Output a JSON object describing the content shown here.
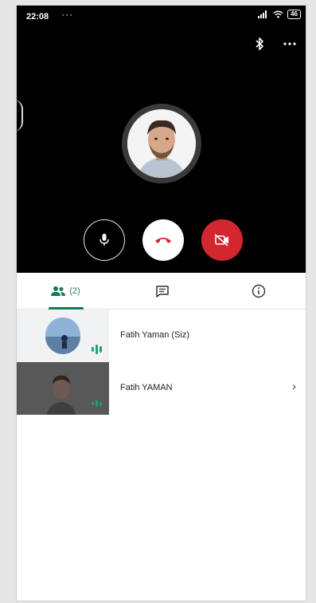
{
  "status_bar": {
    "time": "22:08",
    "dots": "···",
    "battery": "46"
  },
  "call": {
    "top_icons": [
      "bluetooth-icon",
      "more-options-icon"
    ],
    "controls": [
      "microphone-icon",
      "hang-up-icon",
      "camera-off-icon"
    ]
  },
  "tabs": {
    "people_count": "(2)",
    "items": [
      "people-icon",
      "chat-icon",
      "info-icon"
    ]
  },
  "participants": [
    {
      "name": "Fatih Yaman (Siz)"
    },
    {
      "name": "Fatih YAMAN",
      "chevron": "›"
    }
  ],
  "colors": {
    "hang_up_red": "#d3272f",
    "accent_green": "#127a55",
    "call_background": "#000000"
  }
}
